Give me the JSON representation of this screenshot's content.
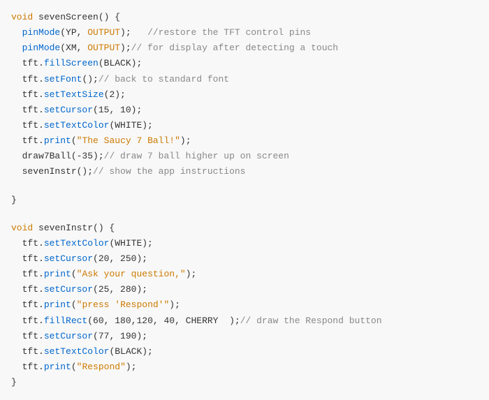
{
  "code": {
    "lines": [
      {
        "id": "l1",
        "tokens": [
          {
            "text": "void ",
            "cls": "c-keyword"
          },
          {
            "text": "sevenScreen",
            "cls": "c-funcname"
          },
          {
            "text": "() {",
            "cls": "c-default"
          }
        ]
      },
      {
        "id": "l2",
        "tokens": [
          {
            "text": "  ",
            "cls": "c-default"
          },
          {
            "text": "pinMode",
            "cls": "c-method"
          },
          {
            "text": "(YP, ",
            "cls": "c-default"
          },
          {
            "text": "OUTPUT",
            "cls": "c-pin"
          },
          {
            "text": ");   //restore the TFT control pins",
            "cls": "c-comment"
          }
        ]
      },
      {
        "id": "l3",
        "tokens": [
          {
            "text": "  ",
            "cls": "c-default"
          },
          {
            "text": "pinMode",
            "cls": "c-method"
          },
          {
            "text": "(XM, ",
            "cls": "c-default"
          },
          {
            "text": "OUTPUT",
            "cls": "c-pin"
          },
          {
            "text": ");//  for display after detecting a touch",
            "cls": "c-comment"
          }
        ]
      },
      {
        "id": "l4",
        "tokens": [
          {
            "text": "  tft.",
            "cls": "c-obj"
          },
          {
            "text": "fillScreen",
            "cls": "c-method"
          },
          {
            "text": "(BLACK);",
            "cls": "c-default"
          }
        ]
      },
      {
        "id": "l5",
        "tokens": [
          {
            "text": "  tft.",
            "cls": "c-obj"
          },
          {
            "text": "setFont",
            "cls": "c-method"
          },
          {
            "text": "();// back to standard font",
            "cls": "c-comment"
          }
        ]
      },
      {
        "id": "l6",
        "tokens": [
          {
            "text": "  tft.",
            "cls": "c-obj"
          },
          {
            "text": "setTextSize",
            "cls": "c-method"
          },
          {
            "text": "(2);",
            "cls": "c-default"
          }
        ]
      },
      {
        "id": "l7",
        "tokens": [
          {
            "text": "  tft.",
            "cls": "c-obj"
          },
          {
            "text": "setCursor",
            "cls": "c-method"
          },
          {
            "text": "(15, 10);",
            "cls": "c-default"
          }
        ]
      },
      {
        "id": "l8",
        "tokens": [
          {
            "text": "  tft.",
            "cls": "c-obj"
          },
          {
            "text": "setTextColor",
            "cls": "c-method"
          },
          {
            "text": "(WHITE);",
            "cls": "c-default"
          }
        ]
      },
      {
        "id": "l9",
        "tokens": [
          {
            "text": "  tft.",
            "cls": "c-obj"
          },
          {
            "text": "print",
            "cls": "c-method"
          },
          {
            "text": "(",
            "cls": "c-default"
          },
          {
            "text": "\"The Saucy 7 Ball!\"",
            "cls": "c-string"
          },
          {
            "text": ");",
            "cls": "c-default"
          }
        ]
      },
      {
        "id": "l10",
        "tokens": [
          {
            "text": "  draw7Ball(-35);//  draw 7 ball higher up on screen",
            "cls": "c-comment",
            "prefix": "  draw7Ball(-35);",
            "comment": "//  draw 7 ball higher up on screen"
          }
        ]
      },
      {
        "id": "l11",
        "tokens": [
          {
            "text": "  sevenInstr();//  show the app instructions",
            "cls": "c-comment",
            "prefix": "  sevenInstr();",
            "comment": "//  show the app instructions"
          }
        ]
      },
      {
        "id": "l12",
        "blank": true
      },
      {
        "id": "l13",
        "tokens": [
          {
            "text": "}",
            "cls": "c-default"
          }
        ]
      },
      {
        "id": "l14",
        "blank": true
      },
      {
        "id": "l15",
        "tokens": [
          {
            "text": "void ",
            "cls": "c-keyword"
          },
          {
            "text": "sevenInstr",
            "cls": "c-funcname"
          },
          {
            "text": "() {",
            "cls": "c-default"
          }
        ]
      },
      {
        "id": "l16",
        "tokens": [
          {
            "text": "  tft.",
            "cls": "c-obj"
          },
          {
            "text": "setTextColor",
            "cls": "c-method"
          },
          {
            "text": "(WHITE);",
            "cls": "c-default"
          }
        ]
      },
      {
        "id": "l17",
        "tokens": [
          {
            "text": "  tft.",
            "cls": "c-obj"
          },
          {
            "text": "setCursor",
            "cls": "c-method"
          },
          {
            "text": "(20, 250);",
            "cls": "c-default"
          }
        ]
      },
      {
        "id": "l18",
        "tokens": [
          {
            "text": "  tft.",
            "cls": "c-obj"
          },
          {
            "text": "print",
            "cls": "c-method"
          },
          {
            "text": "(",
            "cls": "c-default"
          },
          {
            "text": "\"Ask your question,\"",
            "cls": "c-string"
          },
          {
            "text": ");",
            "cls": "c-default"
          }
        ]
      },
      {
        "id": "l19",
        "tokens": [
          {
            "text": "  tft.",
            "cls": "c-obj"
          },
          {
            "text": "setCursor",
            "cls": "c-method"
          },
          {
            "text": "(25, 280);",
            "cls": "c-default"
          }
        ]
      },
      {
        "id": "l20",
        "tokens": [
          {
            "text": "  tft.",
            "cls": "c-obj"
          },
          {
            "text": "print",
            "cls": "c-method"
          },
          {
            "text": "(",
            "cls": "c-default"
          },
          {
            "text": "\"press 'Respond'\"",
            "cls": "c-string"
          },
          {
            "text": ");",
            "cls": "c-default"
          }
        ]
      },
      {
        "id": "l21",
        "tokens": [
          {
            "text": "  tft.",
            "cls": "c-obj"
          },
          {
            "text": "fillRect",
            "cls": "c-method"
          },
          {
            "text": "(60, 180,120, 40, CHERRY  );// draw the Respond button",
            "cls": "c-comment",
            "prefix": "(60, 180,120, 40, CHERRY  );",
            "comment": "// draw the Respond button"
          }
        ]
      },
      {
        "id": "l22",
        "tokens": [
          {
            "text": "  tft.",
            "cls": "c-obj"
          },
          {
            "text": "setCursor",
            "cls": "c-method"
          },
          {
            "text": "(77, 190);",
            "cls": "c-default"
          }
        ]
      },
      {
        "id": "l23",
        "tokens": [
          {
            "text": "  tft.",
            "cls": "c-obj"
          },
          {
            "text": "setTextColor",
            "cls": "c-method"
          },
          {
            "text": "(BLACK);",
            "cls": "c-default"
          }
        ]
      },
      {
        "id": "l24",
        "tokens": [
          {
            "text": "  tft.",
            "cls": "c-obj"
          },
          {
            "text": "print",
            "cls": "c-method"
          },
          {
            "text": "(",
            "cls": "c-default"
          },
          {
            "text": "\"Respond\"",
            "cls": "c-string"
          },
          {
            "text": ");",
            "cls": "c-default"
          }
        ]
      },
      {
        "id": "l25",
        "tokens": [
          {
            "text": "}",
            "cls": "c-default"
          }
        ]
      }
    ]
  }
}
